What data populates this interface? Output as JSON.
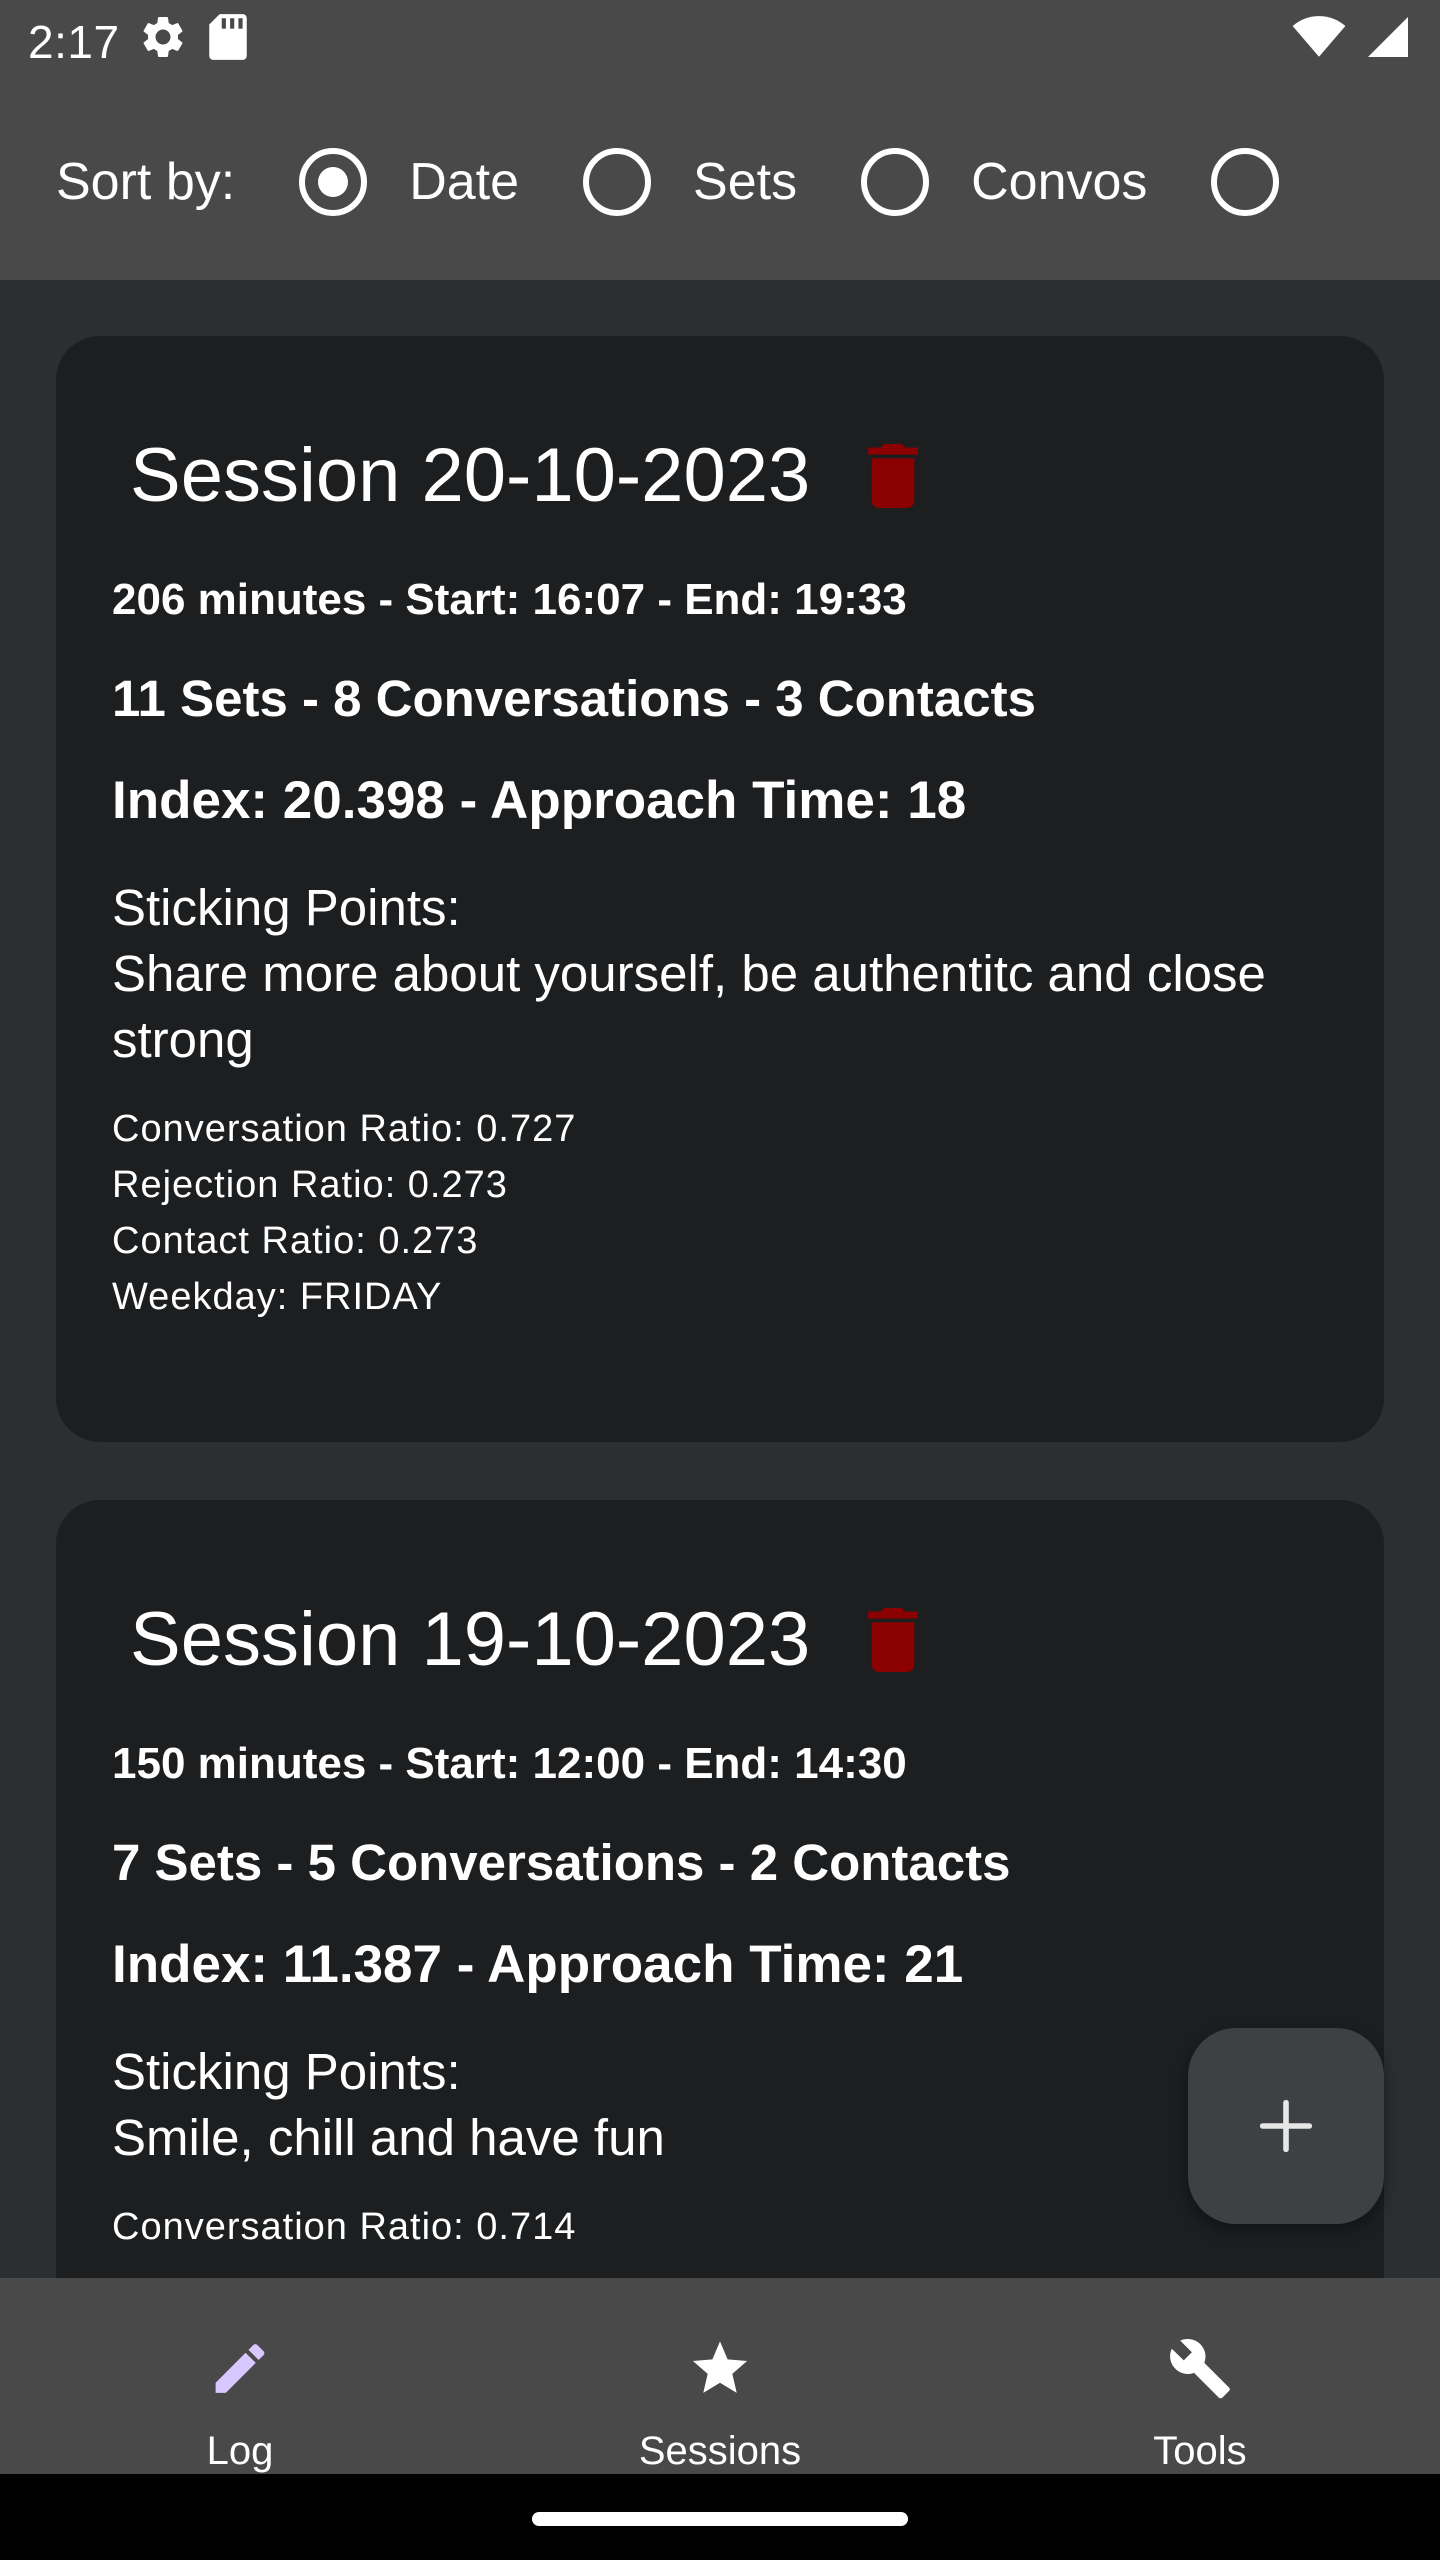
{
  "status_bar": {
    "time": "2:17",
    "icons": [
      "settings-gear-icon",
      "sd-card-icon",
      "wifi-icon",
      "cell-signal-icon"
    ]
  },
  "sort": {
    "label": "Sort by:",
    "options": [
      {
        "label": "Date",
        "selected": true
      },
      {
        "label": "Sets",
        "selected": false
      },
      {
        "label": "Convos",
        "selected": false
      },
      {
        "label": "",
        "selected": false
      }
    ]
  },
  "sessions": [
    {
      "title": "Session 20-10-2023",
      "duration_line": "206 minutes - Start: 16:07 - End: 19:33",
      "counts_line": "11 Sets - 8 Conversations - 3 Contacts",
      "index_line": "Index: 20.398 - Approach Time: 18",
      "sticking_label": "Sticking Points:",
      "sticking_text": "Share more about yourself, be authentitc and close strong",
      "conversation_ratio": "Conversation Ratio: 0.727",
      "rejection_ratio": "Rejection Ratio: 0.273",
      "contact_ratio": "Contact Ratio: 0.273",
      "weekday": "Weekday: FRIDAY"
    },
    {
      "title": "Session 19-10-2023",
      "duration_line": "150 minutes - Start: 12:00 - End: 14:30",
      "counts_line": "7 Sets - 5 Conversations - 2 Contacts",
      "index_line": "Index: 11.387 - Approach Time: 21",
      "sticking_label": "Sticking Points:",
      "sticking_text": "Smile, chill and have fun",
      "conversation_ratio": "Conversation Ratio: 0.714"
    }
  ],
  "fab": {
    "icon": "plus-icon"
  },
  "bottom_nav": {
    "items": [
      {
        "icon": "pencil-icon",
        "label": "Log"
      },
      {
        "icon": "star-icon",
        "label": "Sessions"
      },
      {
        "icon": "wrench-icon",
        "label": "Tools"
      }
    ]
  },
  "colors": {
    "bars": "#494949",
    "background": "#2b2f31",
    "card": "#1c1e20",
    "trash": "#8b0000",
    "nav_icon": "#d9c7ff"
  }
}
